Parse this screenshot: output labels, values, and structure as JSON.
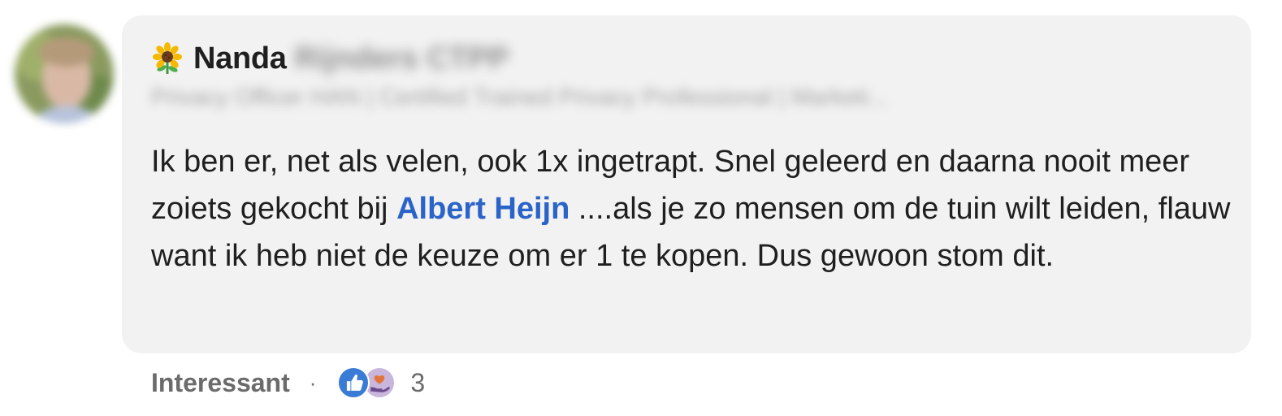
{
  "author": {
    "first_name": "Nanda",
    "last_name": "Rijnders CTPP",
    "headline": "Privacy Officer HAN | Certified Trained Privacy Professional | Marketi...",
    "avatar_icon": "profile-photo",
    "name_prefix_icon": "sunflower-emoji"
  },
  "comment": {
    "text_before_mention": "Ik ben er, net als velen, ook 1x ingetrapt. Snel geleerd en daarna nooit meer zoiets gekocht bij ",
    "mention": "Albert Heijn",
    "text_after_mention": " ....als je zo mensen om de tuin wilt leiden, flauw want ik heb niet de keuze om er 1 te kopen. Dus gewoon stom dit."
  },
  "actions": {
    "react_label": "Interessant",
    "separator": "·",
    "reaction_count": "3",
    "reaction_icons": [
      "like-icon",
      "support-icon"
    ]
  },
  "colors": {
    "bubble_background": "#f2f2f2",
    "mention": "#2b64c8",
    "like_reaction": "#3a7bd5",
    "muted_text": "#6b6b6b"
  }
}
